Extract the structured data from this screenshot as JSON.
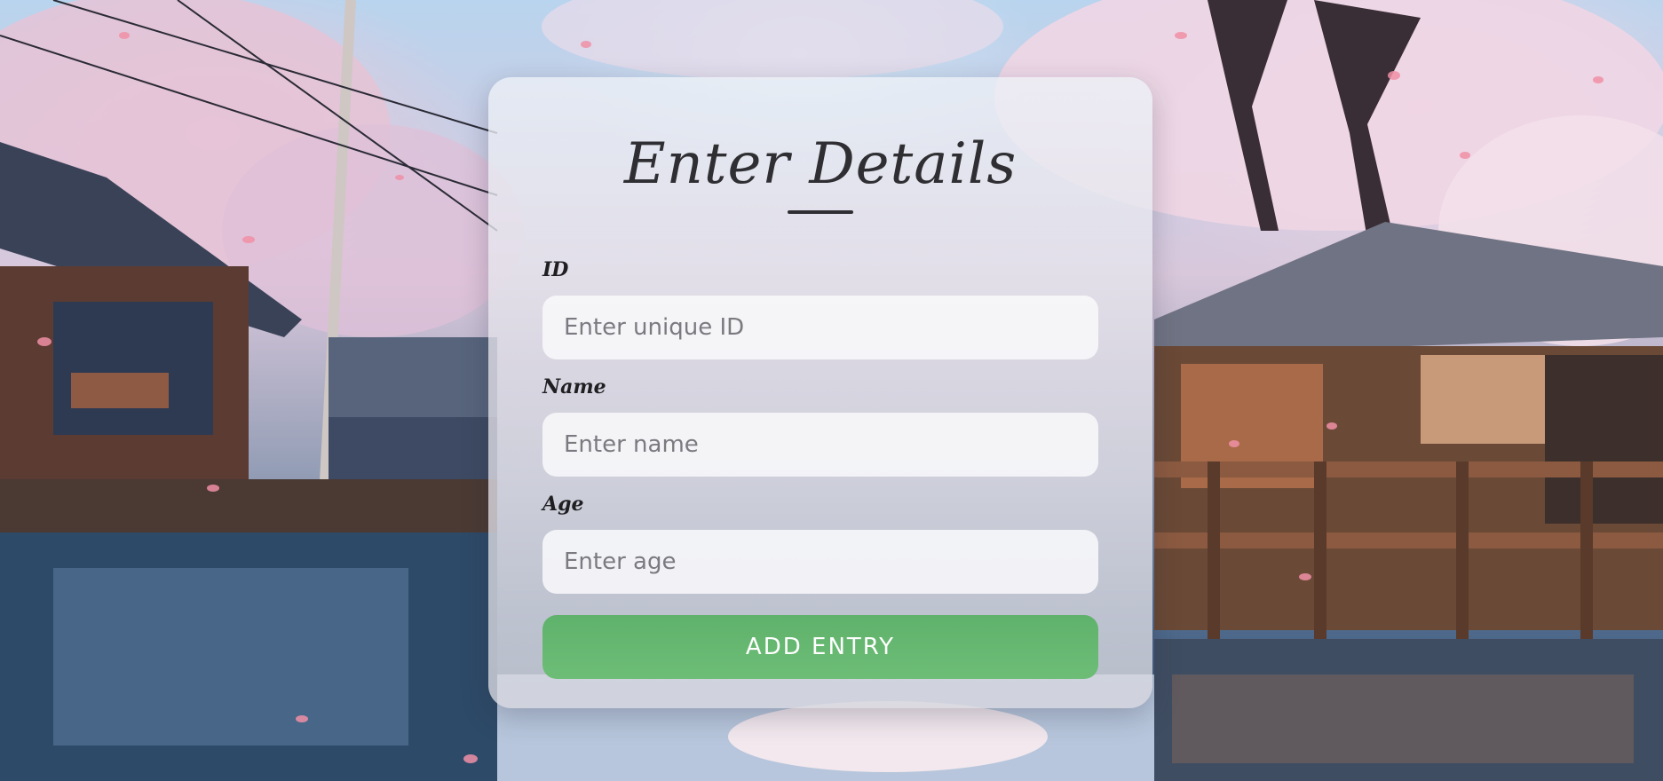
{
  "form": {
    "title": "Enter Details",
    "fields": [
      {
        "label": "ID",
        "placeholder": "Enter unique ID",
        "value": ""
      },
      {
        "label": "Name",
        "placeholder": "Enter name",
        "value": ""
      },
      {
        "label": "Age",
        "placeholder": "Enter age",
        "value": ""
      }
    ],
    "submit_label": "ADD ENTRY"
  },
  "colors": {
    "accent_button": "#66b872",
    "title_text": "#2f2f33",
    "blossom_pink": "#e9b7cc"
  }
}
